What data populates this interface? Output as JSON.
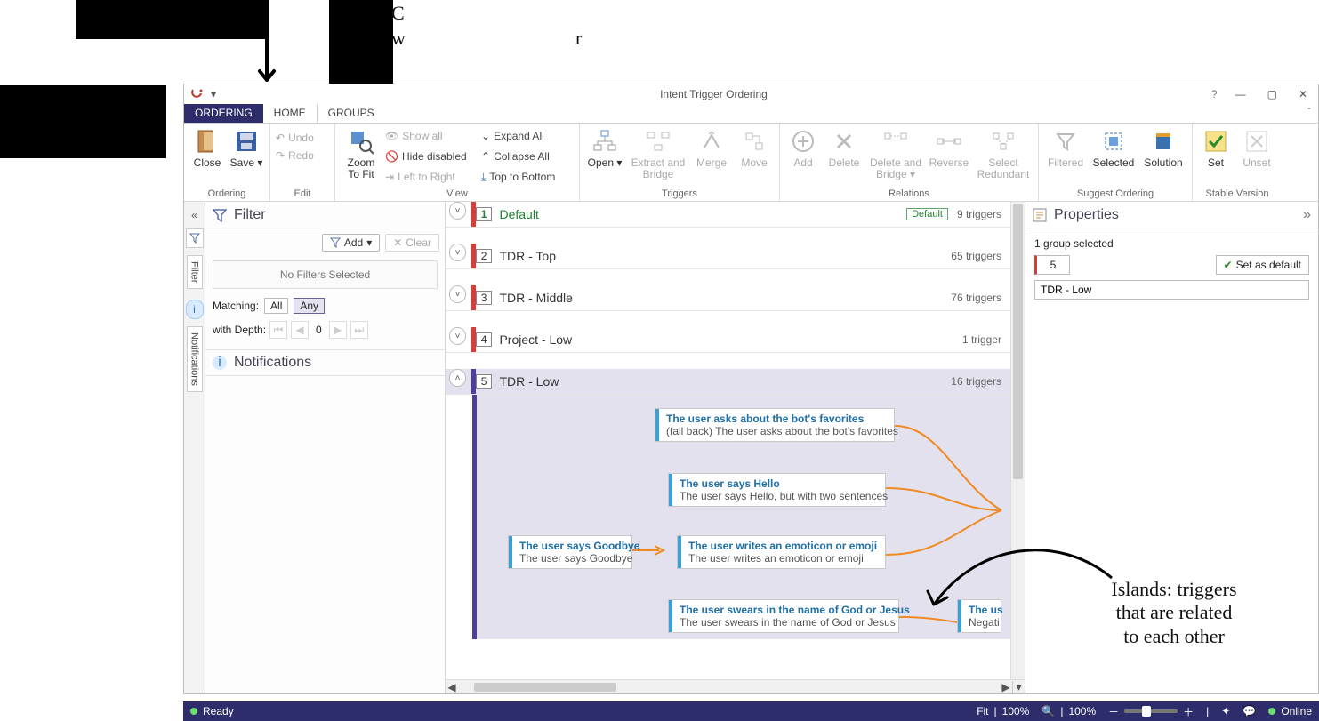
{
  "window": {
    "title": "Intent Trigger Ordering",
    "help": "?"
  },
  "tabs": {
    "ordering": "ORDERING",
    "home": "HOME",
    "groups": "GROUPS"
  },
  "ribbon": {
    "ordering": {
      "close": "Close",
      "save": "Save",
      "label": "Ordering"
    },
    "edit": {
      "undo": "Undo",
      "redo": "Redo",
      "label": "Edit"
    },
    "view": {
      "zoom": "Zoom To Fit",
      "showall": "Show all",
      "hidedisabled": "Hide disabled",
      "ltr": "Left to Right",
      "expand": "Expand All",
      "collapse": "Collapse All",
      "ttb": "Top to Bottom",
      "label": "View"
    },
    "triggers": {
      "open": "Open",
      "extract": "Extract and Bridge",
      "merge": "Merge",
      "move": "Move",
      "label": "Triggers"
    },
    "relations": {
      "add": "Add",
      "del": "Delete",
      "delbridge": "Delete and Bridge",
      "reverse": "Reverse",
      "selred": "Select Redundant",
      "label": "Relations"
    },
    "suggest": {
      "filtered": "Filtered",
      "selected": "Selected",
      "solution": "Solution",
      "label": "Suggest Ordering"
    },
    "stable": {
      "set": "Set",
      "unset": "Unset",
      "label": "Stable Version"
    }
  },
  "rail": {
    "filter": "Filter",
    "notifications": "Notifications"
  },
  "filter": {
    "title": "Filter",
    "add": "Add",
    "clear": "Clear",
    "nofilters": "No Filters Selected",
    "matching": "Matching:",
    "all": "All",
    "any": "Any",
    "depth": "with Depth:",
    "depthval": "0",
    "notifications": "Notifications"
  },
  "groups": [
    {
      "n": "1",
      "name": "Default",
      "count": "9 triggers",
      "default": "Default",
      "bar": "red",
      "green": true
    },
    {
      "n": "2",
      "name": "TDR - Top",
      "count": "65 triggers",
      "bar": "red"
    },
    {
      "n": "3",
      "name": "TDR - Middle",
      "count": "76 triggers",
      "bar": "red"
    },
    {
      "n": "4",
      "name": "Project - Low",
      "count": "1 trigger",
      "bar": "red"
    },
    {
      "n": "5",
      "name": "TDR - Low",
      "count": "16 triggers",
      "bar": "purple",
      "selected": true,
      "expanded": true
    }
  ],
  "nodes": {
    "a": {
      "t1": "The user asks about the bot's favorites",
      "t2": "(fall back) The user asks about the bot's favorites"
    },
    "b": {
      "t1": "The user says Hello",
      "t2": "The user says Hello, but with two sentences"
    },
    "c": {
      "t1": "The user says Goodbye",
      "t2": "The user says Goodbye"
    },
    "d": {
      "t1": "The user writes an emoticon or emoji",
      "t2": "The user writes an emoticon or emoji"
    },
    "e": {
      "t1": "The user swears in the name of God or Jesus",
      "t2": "The user swears in the name of God or Jesus"
    },
    "f": {
      "t1": "The us",
      "t2": "Negati"
    }
  },
  "properties": {
    "title": "Properties",
    "summary": "1 group selected",
    "num": "5",
    "setdefault": "Set as default",
    "name": "TDR - Low"
  },
  "status": {
    "ready": "Ready",
    "fit": "Fit",
    "zoom1": "100%",
    "zoom2": "100%",
    "online": "Online"
  },
  "annotations": {
    "cannotread1": "C",
    "cannotread2": "w",
    "cannotread3": "r",
    "islands1": "Islands: triggers",
    "islands2": "that are related",
    "islands3": "to each other"
  }
}
